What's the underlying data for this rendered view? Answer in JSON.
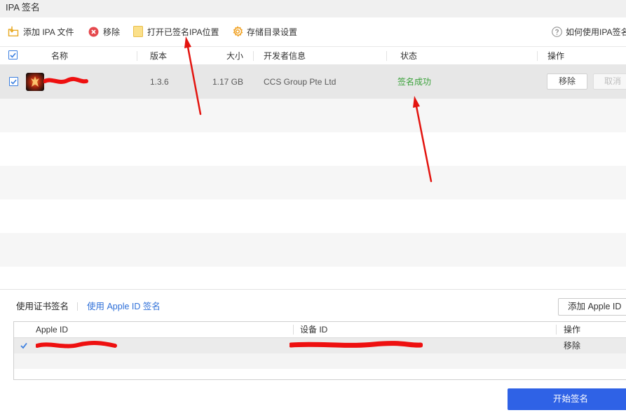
{
  "window": {
    "title": "IPA 签名"
  },
  "toolbar": {
    "add_ipa": {
      "label": "添加 IPA 文件",
      "icon": "folder-add-icon"
    },
    "remove": {
      "label": "移除",
      "icon": "remove-icon"
    },
    "open_signed": {
      "label": "打开已签名IPA位置",
      "icon": "folder-icon"
    },
    "storage_settings": {
      "label": "存储目录设置",
      "icon": "gear-icon"
    },
    "help": {
      "label": "如何使用IPA签名",
      "icon": "help-icon"
    }
  },
  "ipa_table": {
    "select_all_checked": true,
    "columns": {
      "name": "名称",
      "version": "版本",
      "size": "大小",
      "developer": "开发者信息",
      "status": "状态",
      "actions": "操作"
    },
    "rows": [
      {
        "checked": true,
        "selected": true,
        "icon": "app-icon",
        "name_redacted": true,
        "version": "1.3.6",
        "size": "1.17 GB",
        "developer": "CCS Group Pte Ltd",
        "status": "签名成功",
        "remove_label": "移除",
        "cancel_label": "取消",
        "cancel_enabled": false
      }
    ]
  },
  "sign_mode": {
    "tabs": [
      {
        "label": "使用证书签名",
        "active": false
      },
      {
        "label": "使用 Apple ID 签名",
        "active": true
      }
    ],
    "add_apple_id_label": "添加 Apple ID"
  },
  "apple_id_table": {
    "columns": {
      "apple_id": "Apple ID",
      "device_id": "设备 ID",
      "actions": "操作"
    },
    "rows": [
      {
        "selected": true,
        "apple_id_redacted": true,
        "device_id_redacted": true,
        "remove_label": "移除"
      }
    ]
  },
  "start_button": {
    "label": "开始签名"
  },
  "colors": {
    "accent": "#2f62e6",
    "link": "#2e6fd8",
    "checkbox": "#3b7fe0",
    "success": "#3aa13a",
    "danger": "#e5484d",
    "annotation": "#e3140f",
    "redaction": "#ee1010"
  }
}
